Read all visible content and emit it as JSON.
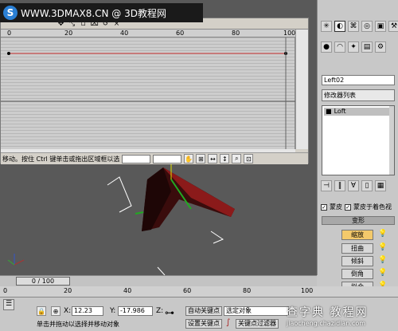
{
  "watermark": {
    "text": "WWW.3DMAX8.CN @ 3D教程网",
    "logo": "S"
  },
  "curve_editor": {
    "ruler_ticks": [
      "0",
      "20",
      "40",
      "60",
      "80",
      "100"
    ],
    "status_text": "移动。按住 Ctrl 键单击或拖出区域框以选",
    "close_glyph": "×"
  },
  "panel": {
    "object_name": "Left02",
    "modifier_list": "修改器列表",
    "stack_item": "Loft",
    "skin_label": "蒙皮",
    "skin_parametric_label": "蒙皮于着色视",
    "deformations_title": "变形",
    "deform_buttons": [
      "缩放",
      "扭曲",
      "倾斜",
      "倒角",
      "拟合"
    ]
  },
  "time_slider": {
    "frame": "0 / 100"
  },
  "track_ticks": [
    "0",
    "20",
    "40",
    "60",
    "80",
    "100"
  ],
  "status_bar": {
    "x_label": "X:",
    "x_value": "12.23",
    "y_label": "Y:",
    "y_value": "-17.986",
    "z_label": "Z:",
    "auto_key": "自动关键点",
    "set_key": "设置关键点",
    "selected_object": "选定对象",
    "key_filters": "关键点过滤器",
    "prompt": "单击并拖动以选择并移动对象"
  },
  "watermark2": {
    "big": "查字典 教程网",
    "small": "jiaocheng.chazidian.com"
  }
}
